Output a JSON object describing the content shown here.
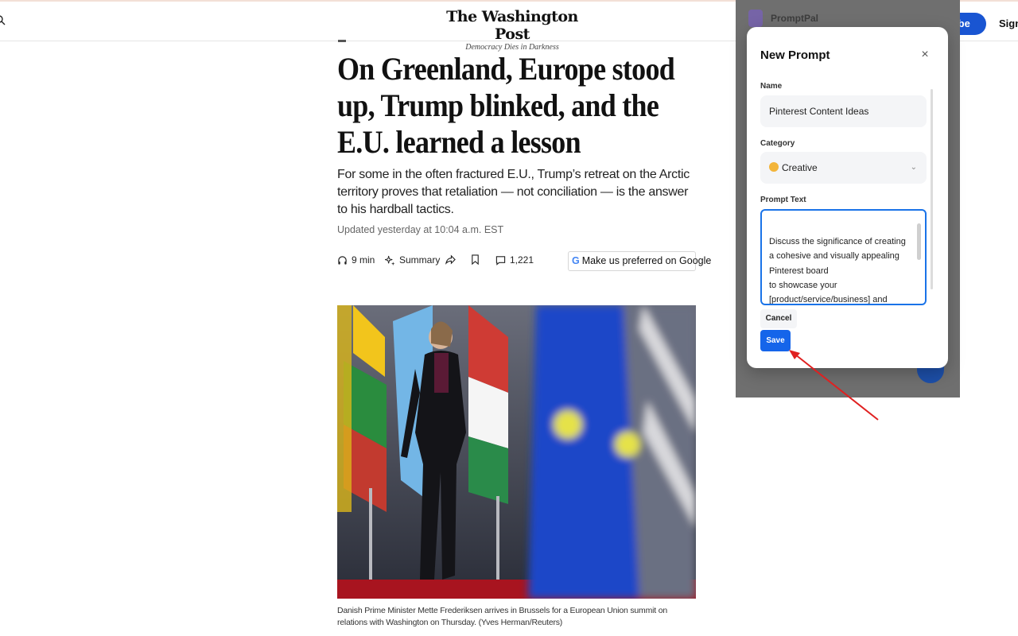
{
  "site": {
    "logo": "The Washington Post",
    "tagline": "Democracy Dies in Darkness",
    "subscribe_label": "ribe",
    "signin_label": "Sign"
  },
  "article": {
    "headline": "On Greenland, Europe stood up, Trump blinked, and the E.U. learned a lesson",
    "dek": "For some in the often fractured E.U., Trump’s retreat on the Arctic territory proves that retaliation — not conciliation — is the answer to his hardball tactics.",
    "timestamp": "Updated yesterday at 10:04 a.m. EST",
    "actions": {
      "listen": "9 min",
      "summary": "Summary",
      "comments": "1,221",
      "google_pref": "Make us preferred on Google",
      "google_letter": "G"
    },
    "caption": "Danish Prime Minister Mette Frederiksen arrives in Brussels for a European Union summit on relations with Washington on Thursday. (Yves Herman/Reuters)"
  },
  "extension": {
    "name": "PromptPal",
    "modal": {
      "title": "New Prompt",
      "close_icon": "×",
      "name_label": "Name",
      "name_value": "Pinterest Content Ideas",
      "category_label": "Category",
      "category_value": "Creative",
      "prompt_label": "Prompt Text",
      "prompt_value": "Discuss the significance of creating a cohesive and visually appealing Pinterest board\nto showcase your [product/service/business] and attract your target audience.",
      "cancel_label": "Cancel",
      "save_label": "Save"
    }
  },
  "colors": {
    "accent": "#1565ea",
    "annotation_arrow": "#e02020"
  }
}
